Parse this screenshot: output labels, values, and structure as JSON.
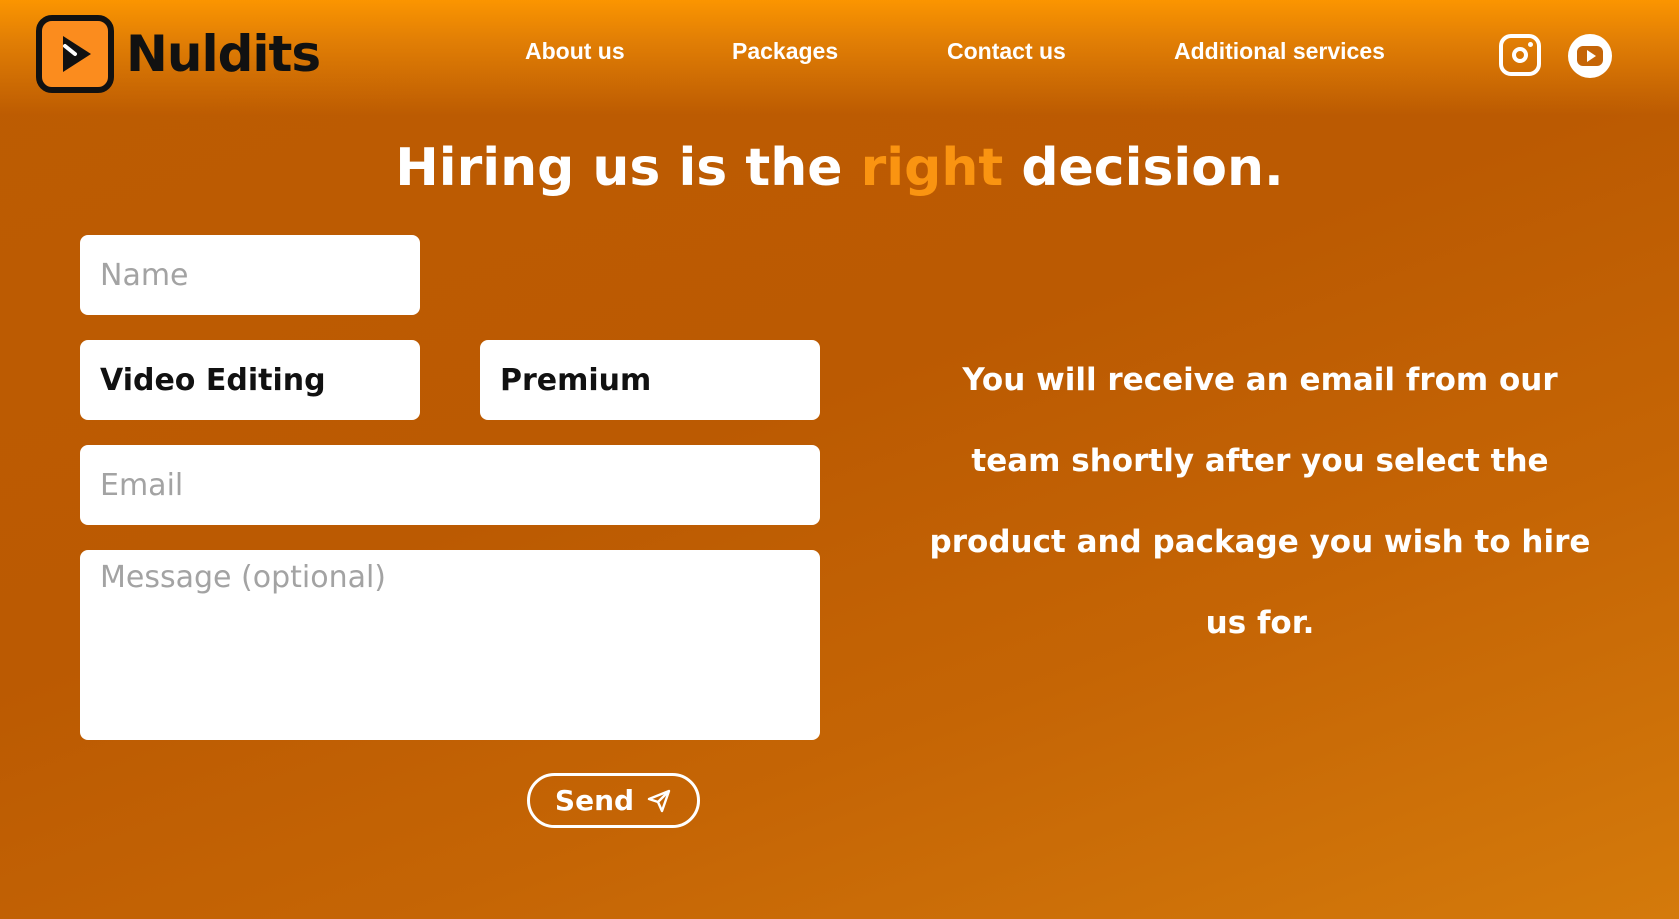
{
  "brand": {
    "name": "Nuldits",
    "logo_icon": "play-logo-icon"
  },
  "nav": {
    "items": [
      {
        "label": "About us"
      },
      {
        "label": "Packages"
      },
      {
        "label": "Contact us"
      },
      {
        "label": "Additional services"
      }
    ]
  },
  "social": {
    "instagram": "instagram-icon",
    "youtube": "youtube-icon"
  },
  "headline": {
    "before": "Hiring us is the",
    "accent": "right",
    "after": "decision."
  },
  "form": {
    "name_placeholder": "Name",
    "product_value": "Video Editing",
    "package_value": "Premium",
    "email_placeholder": "Email",
    "message_placeholder": "Message (optional)",
    "send_label": "Send"
  },
  "info": {
    "text": "You will receive an email from our team shortly after you select the product and package you wish to hire us for."
  },
  "colors": {
    "accent": "#fa9411",
    "background": "#bb5a02",
    "header_top": "#fb9500"
  }
}
